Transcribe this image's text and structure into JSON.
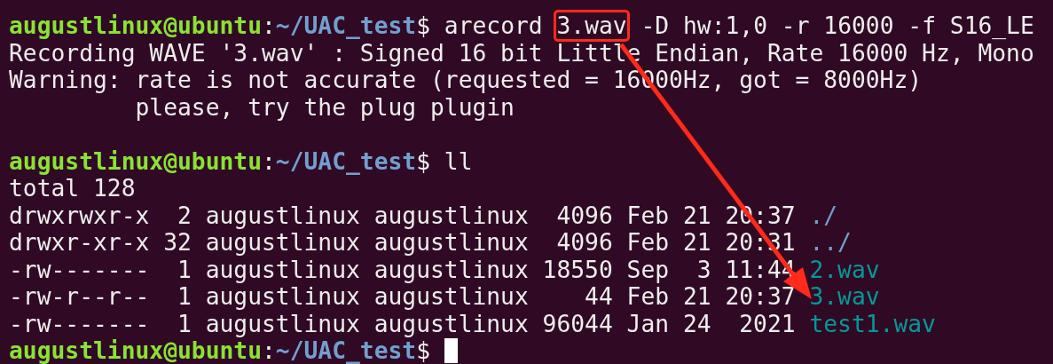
{
  "terminal": {
    "lines": [
      {
        "segments": [
          {
            "kind": "user",
            "text": "augustlinux@ubuntu"
          },
          {
            "kind": "plain",
            "text": ":"
          },
          {
            "kind": "path",
            "text": "~/UAC_test"
          },
          {
            "kind": "plain",
            "text": "$ arecord "
          },
          {
            "kind": "plain",
            "text": "3.wav",
            "boxed": true
          },
          {
            "kind": "plain",
            "text": " -D hw:1,0 -r 16000 -f S16_LE"
          }
        ]
      },
      {
        "segments": [
          {
            "kind": "plain",
            "text": "Recording WAVE '3.wav' : Signed 16 bit Little Endian, Rate 16000 Hz, Mono"
          }
        ]
      },
      {
        "segments": [
          {
            "kind": "plain",
            "text": "Warning: rate is not accurate (requested = 16000Hz, got = 8000Hz)"
          }
        ]
      },
      {
        "segments": [
          {
            "kind": "plain",
            "text": "         please, try the plug plugin"
          }
        ]
      },
      {
        "blank_before": true,
        "segments": [
          {
            "kind": "user",
            "text": "augustlinux@ubuntu"
          },
          {
            "kind": "plain",
            "text": ":"
          },
          {
            "kind": "path",
            "text": "~/UAC_test"
          },
          {
            "kind": "plain",
            "text": "$ ll"
          }
        ]
      },
      {
        "segments": [
          {
            "kind": "plain",
            "text": "total 128"
          }
        ]
      },
      {
        "segments": [
          {
            "kind": "plain",
            "text": "drwxrwxr-x  2 augustlinux augustlinux  4096 Feb 21 20:37 "
          },
          {
            "kind": "dir",
            "text": "./"
          }
        ]
      },
      {
        "segments": [
          {
            "kind": "plain",
            "text": "drwxr-xr-x 32 augustlinux augustlinux  4096 Feb 21 20:31 "
          },
          {
            "kind": "dir",
            "text": "../"
          }
        ]
      },
      {
        "segments": [
          {
            "kind": "plain",
            "text": "-rw-------  1 augustlinux augustlinux 18550 Sep  3 11:44 "
          },
          {
            "kind": "file",
            "text": "2.wav"
          }
        ]
      },
      {
        "segments": [
          {
            "kind": "plain",
            "text": "-rw-r--r--  1 augustlinux augustlinux    44 Feb 21 20:37 "
          },
          {
            "kind": "file",
            "text": "3.wav"
          }
        ]
      },
      {
        "segments": [
          {
            "kind": "plain",
            "text": "-rw-------  1 augustlinux augustlinux 96044 Jan 24  2021 "
          },
          {
            "kind": "file",
            "text": "test1.wav"
          }
        ]
      },
      {
        "segments": [
          {
            "kind": "user",
            "text": "augustlinux@ubuntu"
          },
          {
            "kind": "plain",
            "text": ":"
          },
          {
            "kind": "path",
            "text": "~/UAC_test"
          },
          {
            "kind": "plain",
            "text": "$ "
          }
        ],
        "cursor": true
      }
    ]
  }
}
